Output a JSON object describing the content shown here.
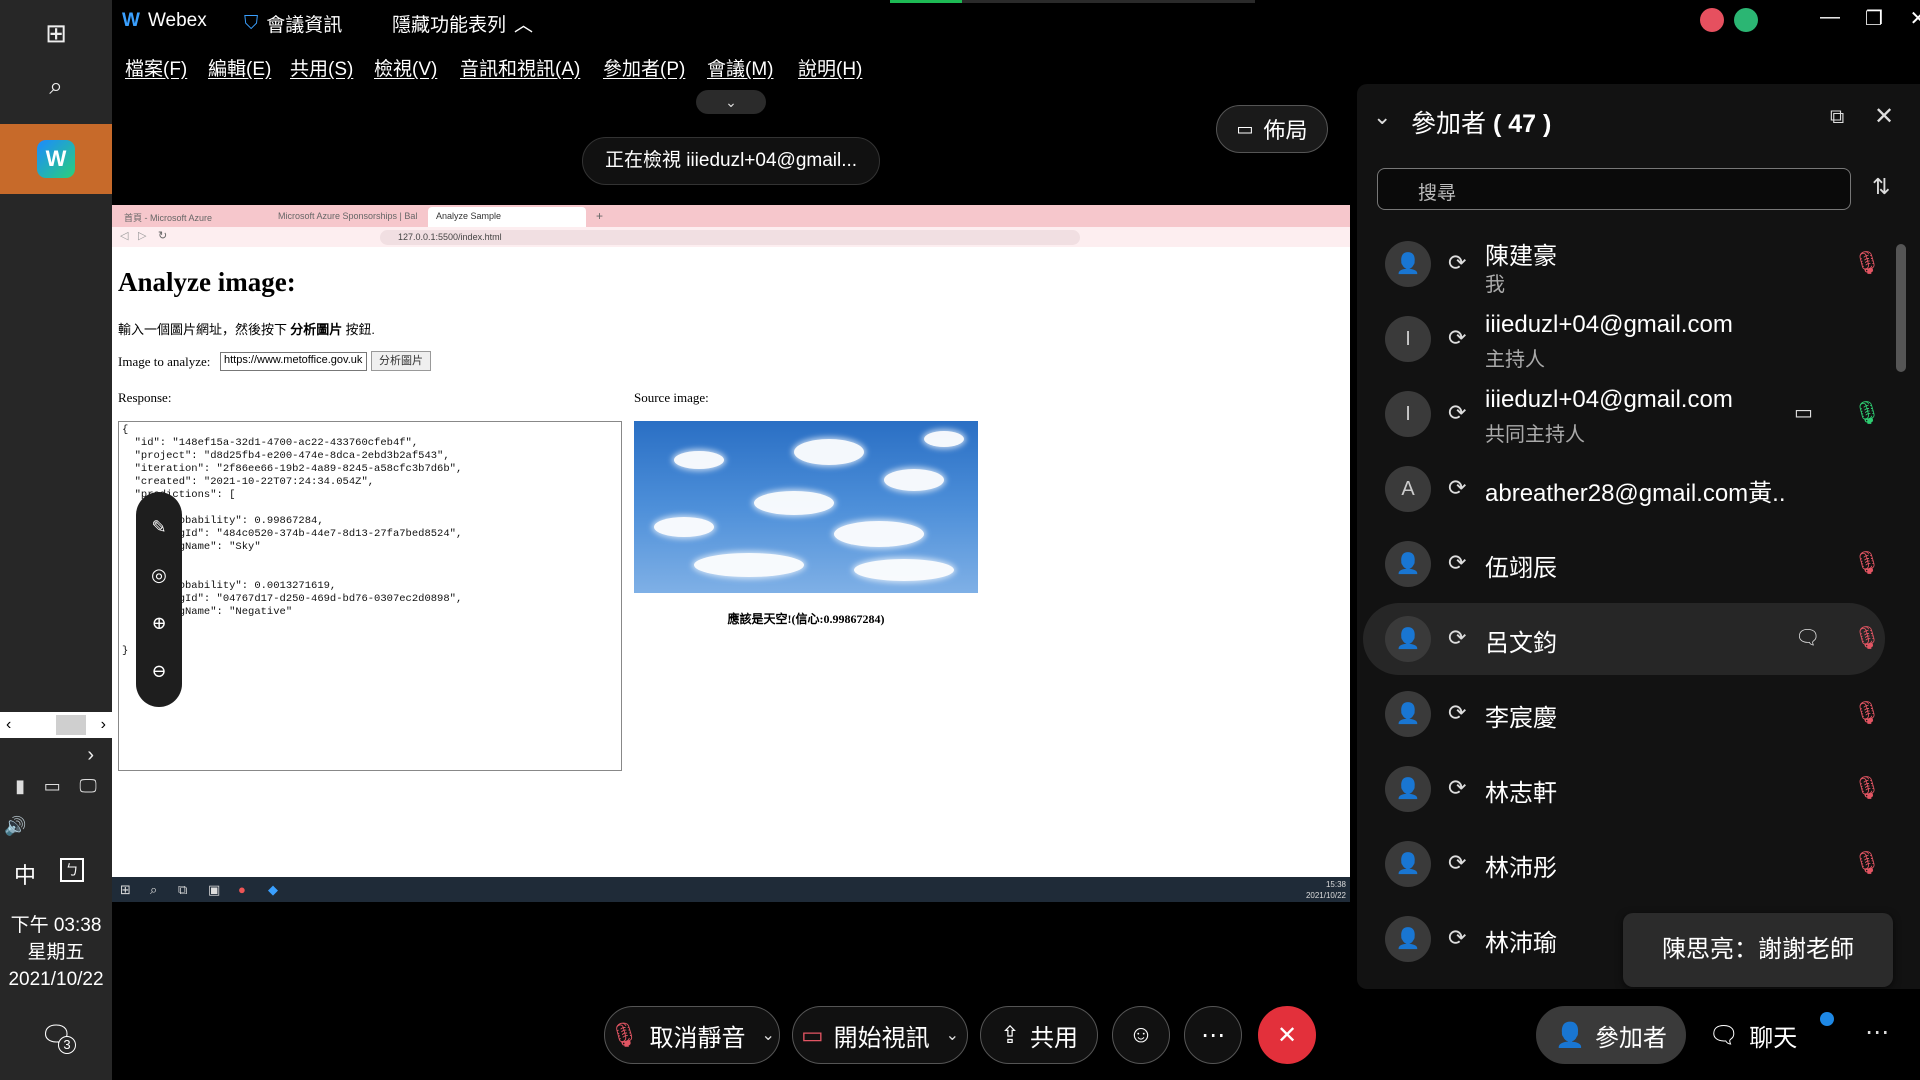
{
  "taskbar": {
    "clock_time": "下午 03:38",
    "clock_day": "星期五",
    "clock_date": "2021/10/22",
    "ime": "中",
    "notification_count": "3"
  },
  "titlebar": {
    "app_name": "Webex",
    "meeting_info": "會議資訊",
    "hide_toolbar": "隱藏功能表列"
  },
  "menu": [
    "檔案(F)",
    "編輯(E)",
    "共用(S)",
    "檢視(V)",
    "音訊和視訊(A)",
    "參加者(P)",
    "會議(M)",
    "說明(H)"
  ],
  "viewing": "正在檢視 iiieduzl+04@gmail...",
  "layout_label": "佈局",
  "shared": {
    "tabs": [
      "首頁 - Microsoft Azure",
      "Microsoft Azure Sponsorships | Bal",
      "Analyze Sample"
    ],
    "url": "127.0.0.1:5500/index.html",
    "heading": "Analyze image:",
    "hint_pre": "輸入一個圖片網址，然後按下 ",
    "hint_bold": "分析圖片",
    "hint_post": " 按鈕.",
    "image_label": "Image to analyze:",
    "image_value": "https://www.metoffice.gov.uk",
    "analyze_button": "分析圖片",
    "response_label": "Response:",
    "source_label": "Source image:",
    "response_json": "{\n  \"id\": \"148ef15a-32d1-4700-ac22-433760cfeb4f\",\n  \"project\": \"d8d25fb4-e200-474e-8dca-2ebd3b2af543\",\n  \"iteration\": \"2f86ee66-19b2-4a89-8245-a58cfc3b7d6b\",\n  \"created\": \"2021-10-22T07:24:34.054Z\",\n  \"predictions\": [\n    {\n      \"probability\": 0.99867284,\n      \"tagId\": \"484c0520-374b-44e7-8d13-27fa7bed8524\",\n      \"tagName\": \"Sky\"\n    },\n    {\n      \"probability\": 0.0013271619,\n      \"tagId\": \"04767d17-d250-469d-bd76-0307ec2d0898\",\n      \"tagName\": \"Negative\"\n    }\n  ]\n}",
    "result": "應該是天空!(信心:0.99867284)",
    "remote_time": "15:38",
    "remote_date": "2021/10/22"
  },
  "panel": {
    "title": "參加者",
    "count": "( 47 )",
    "search_placeholder": "搜尋",
    "participants": [
      {
        "name": "陳建豪",
        "role": "我",
        "avatar": "",
        "mic": "off"
      },
      {
        "name": "iiieduzl+04@gmail.com",
        "role": "主持人",
        "avatar": "I",
        "mic": ""
      },
      {
        "name": "iiieduzl+04@gmail.com",
        "role": "共同主持人",
        "avatar": "I",
        "mic": "on"
      },
      {
        "name": "abreather28@gmail.com黃...",
        "role": "",
        "avatar": "A",
        "mic": ""
      },
      {
        "name": "伍翊辰",
        "role": "",
        "avatar": "",
        "mic": "off"
      },
      {
        "name": "呂文鈞",
        "role": "",
        "avatar": "",
        "mic": "off"
      },
      {
        "name": "李宸慶",
        "role": "",
        "avatar": "",
        "mic": "off"
      },
      {
        "name": "林志軒",
        "role": "",
        "avatar": "",
        "mic": "off"
      },
      {
        "name": "林沛彤",
        "role": "",
        "avatar": "",
        "mic": "off"
      },
      {
        "name": "林沛瑜",
        "role": "",
        "avatar": "",
        "mic": ""
      }
    ]
  },
  "toast": "陳思亮：謝謝老師",
  "controls": {
    "unmute": "取消靜音",
    "start_video": "開始視訊",
    "share": "共用",
    "participants": "參加者",
    "chat": "聊天"
  },
  "colors": {
    "accent_orange": "#c76a2a",
    "end_red": "#e3303b",
    "mic_off": "#e25563",
    "mic_on": "#2ecc71"
  }
}
